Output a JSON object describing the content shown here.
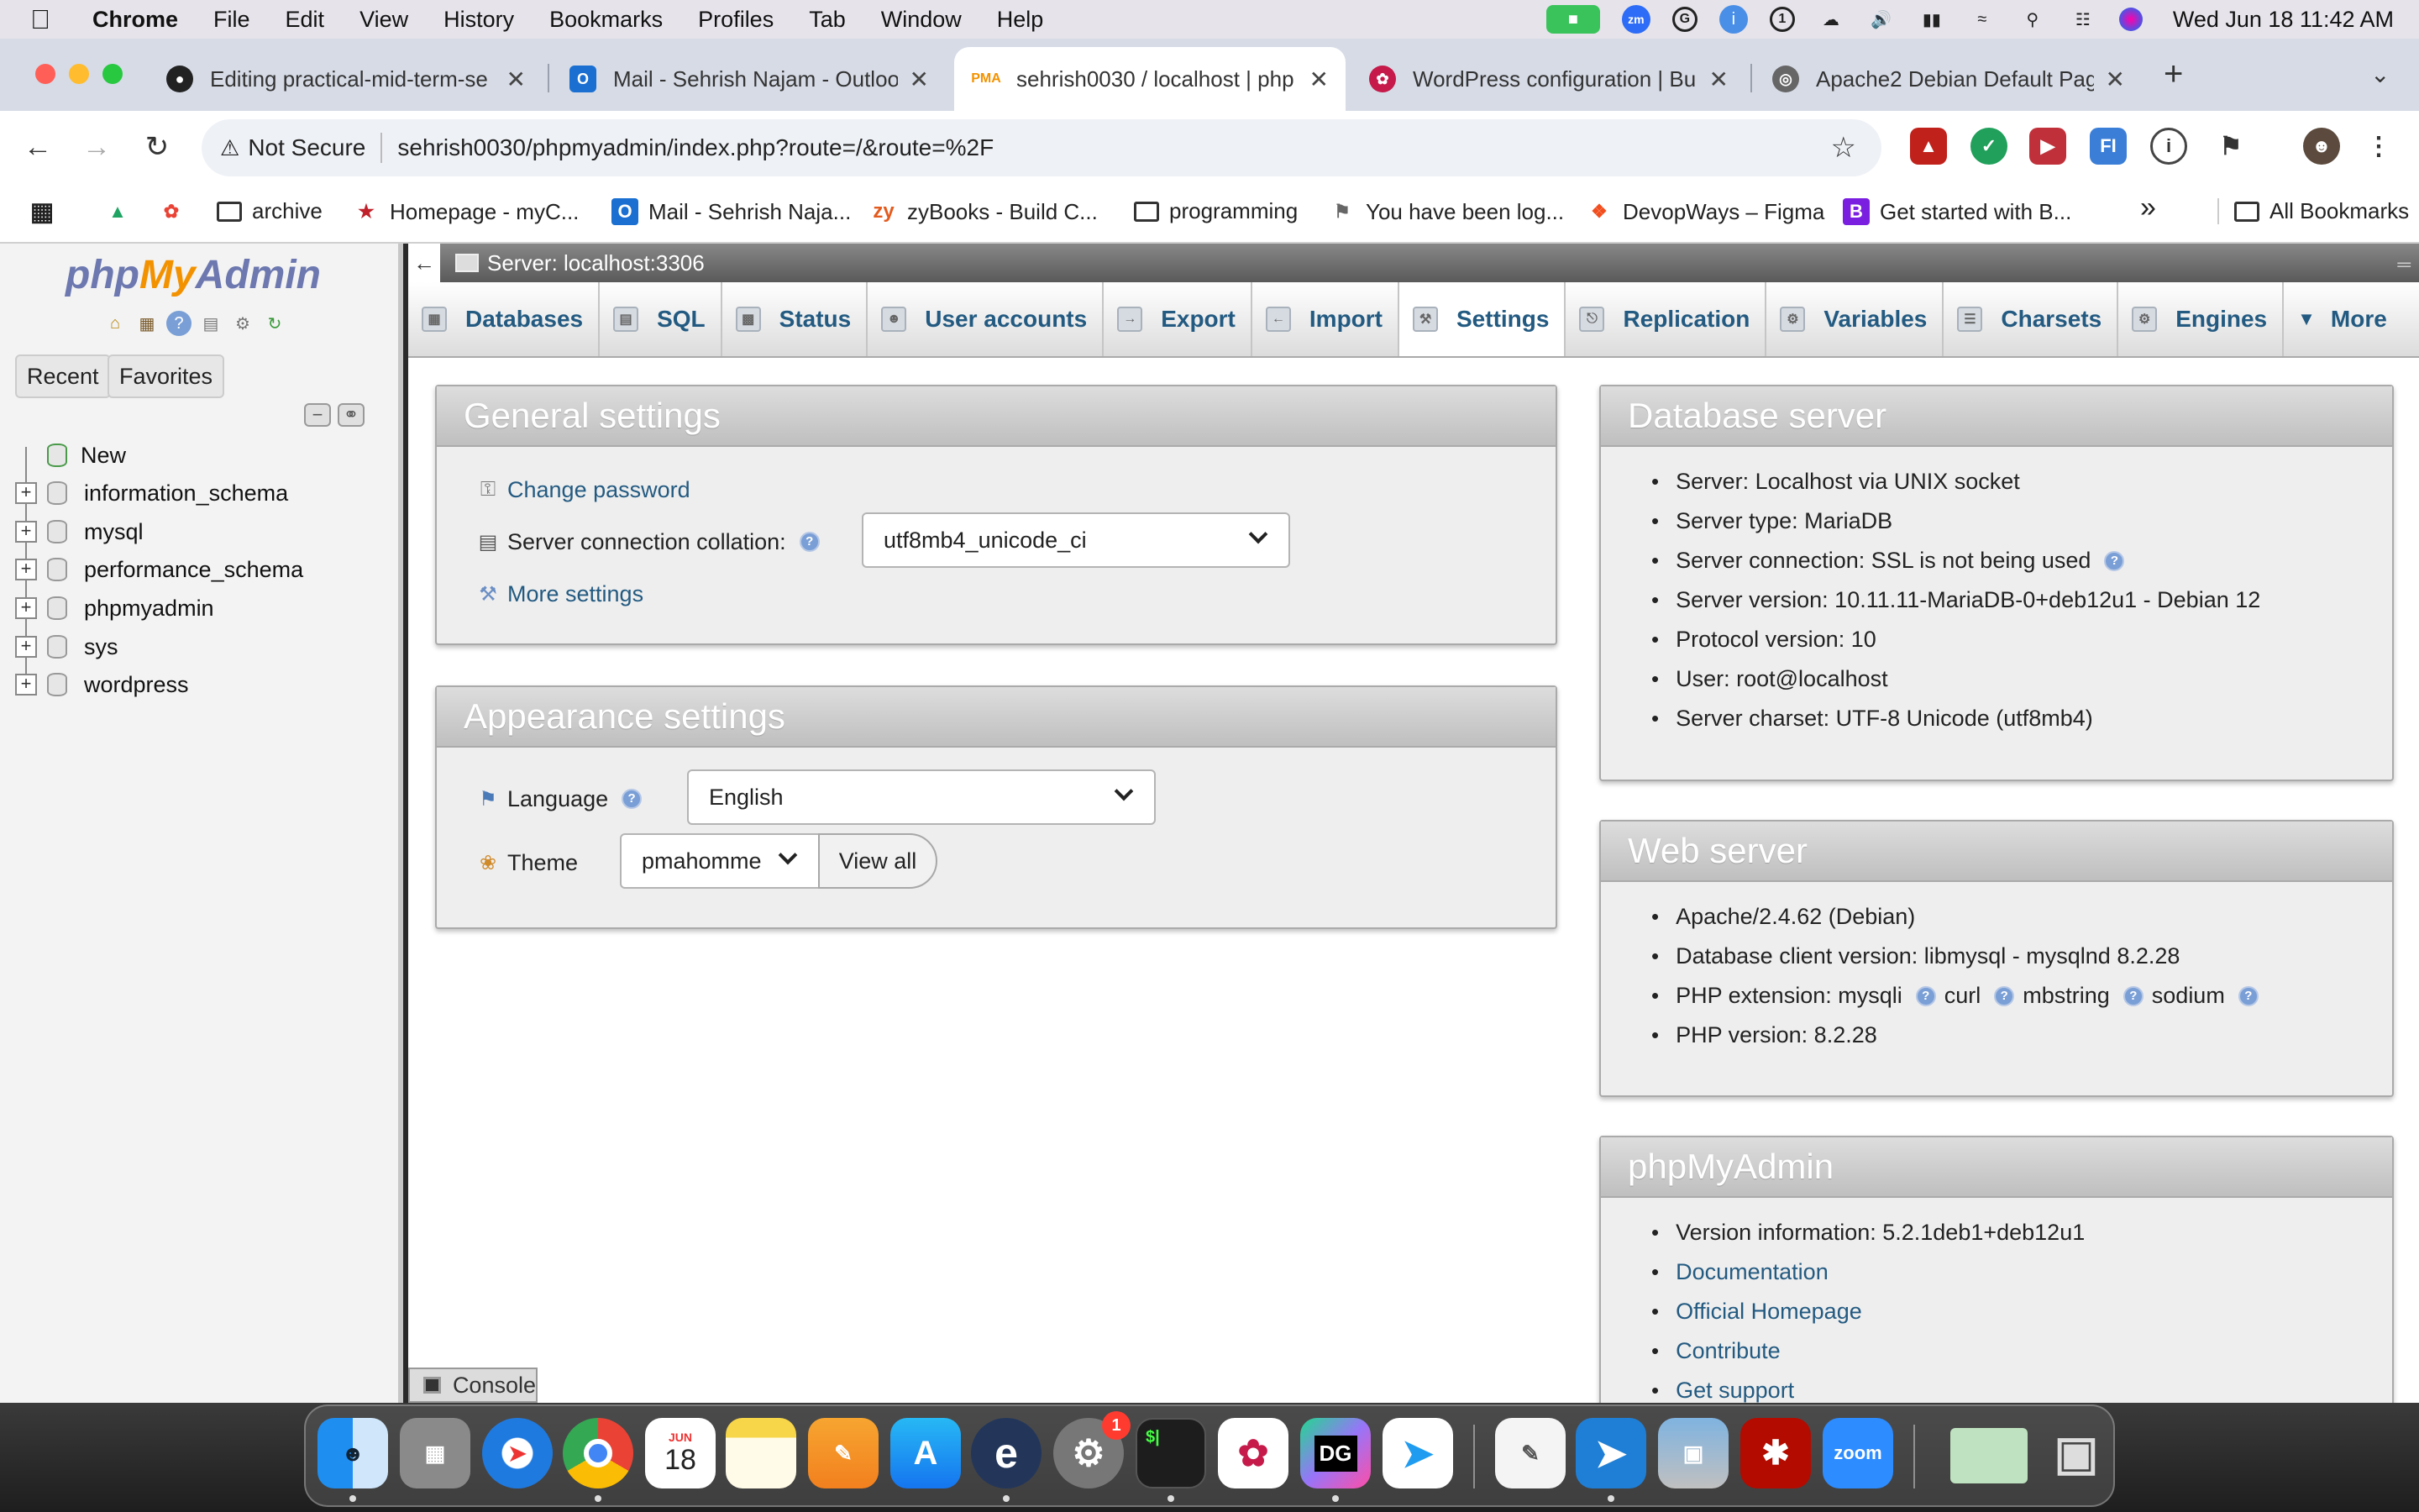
{
  "menubar": {
    "app_name": "Chrome",
    "menus": [
      "File",
      "Edit",
      "View",
      "History",
      "Bookmarks",
      "Profiles",
      "Tab",
      "Window",
      "Help"
    ],
    "clock": "Wed Jun 18  11:42 AM",
    "status_icons": [
      "facetime-icon",
      "zoom-icon",
      "grammarly-icon",
      "info-icon",
      "password-icon",
      "network-icon",
      "volume-icon",
      "battery-icon",
      "wifi-icon",
      "search-icon",
      "control-center-icon",
      "siri-icon"
    ]
  },
  "tabs": [
    {
      "title": "Editing practical-mid-term-se",
      "favicon": "github-icon"
    },
    {
      "title": "Mail - Sehrish Najam - Outloo",
      "favicon": "outlook-icon"
    },
    {
      "title": "sehrish0030 / localhost | php",
      "favicon": "phpmyadmin-icon",
      "active": true
    },
    {
      "title": "WordPress configuration | Bu",
      "favicon": "raspberry-icon"
    },
    {
      "title": "Apache2 Debian Default Page",
      "favicon": "globe-icon"
    }
  ],
  "toolbar": {
    "security": "Not Secure",
    "url": "sehrish0030/phpmyadmin/index.php?route=/&route=%2F"
  },
  "bookmarks": {
    "items": [
      "archive",
      "Homepage - myC...",
      "Mail - Sehrish Naja...",
      "zyBooks - Build C...",
      "programming",
      "You have been log...",
      "DevopWays – Figma",
      "Get started with B..."
    ],
    "overflow": "»",
    "all": "All Bookmarks"
  },
  "nav": {
    "logo": {
      "php": "php",
      "my": "My",
      "admin": "Admin"
    },
    "recent": "Recent",
    "favorites": "Favorites",
    "new_label": "New",
    "databases": [
      "information_schema",
      "mysql",
      "performance_schema",
      "phpmyadmin",
      "sys",
      "wordpress"
    ]
  },
  "server_bar": {
    "title": "Server: localhost:3306"
  },
  "main_tabs": [
    "Databases",
    "SQL",
    "Status",
    "User accounts",
    "Export",
    "Import",
    "Settings",
    "Replication",
    "Variables",
    "Charsets",
    "Engines",
    "More"
  ],
  "general_settings": {
    "title": "General settings",
    "change_password": "Change password",
    "collation_label": "Server connection collation:",
    "collation_value": "utf8mb4_unicode_ci",
    "more_settings": "More settings"
  },
  "appearance_settings": {
    "title": "Appearance settings",
    "language_label": "Language",
    "language_value": "English",
    "theme_label": "Theme",
    "theme_value": "pmahomme",
    "view_all": "View all"
  },
  "database_server": {
    "title": "Database server",
    "items": [
      "Server: Localhost via UNIX socket",
      "Server type: MariaDB",
      "Server connection: SSL is not being used",
      "Server version: 10.11.11-MariaDB-0+deb12u1 - Debian 12",
      "Protocol version: 10",
      "User: root@localhost",
      "Server charset: UTF-8 Unicode (utf8mb4)"
    ]
  },
  "web_server": {
    "title": "Web server",
    "apache": "Apache/2.4.62 (Debian)",
    "client": "Database client version: libmysql - mysqlnd 8.2.28",
    "php_ext_label": "PHP extension: mysqli",
    "ext_curl": "curl",
    "ext_mbstring": "mbstring",
    "ext_sodium": "sodium",
    "php_version": "PHP version: 8.2.28"
  },
  "pma_panel": {
    "title": "phpMyAdmin",
    "version": "Version information: 5.2.1deb1+deb12u1",
    "links": [
      "Documentation",
      "Official Homepage",
      "Contribute",
      "Get support"
    ]
  },
  "console": {
    "label": "Console"
  },
  "dock": {
    "calendar_month": "JUN",
    "calendar_day": "18",
    "settings_badge": "1",
    "apps": [
      "finder",
      "launchpad",
      "safari",
      "chrome",
      "calendar",
      "notes",
      "pages",
      "app-store",
      "eclipse",
      "system-settings",
      "terminal",
      "raspberry-pi-imager",
      "datagrip",
      "vscode",
      "textedit",
      "vscode-2",
      "preview",
      "acrobat",
      "zoom",
      "downloads",
      "trash"
    ]
  },
  "colors": {
    "pma_link": "#235a81",
    "panel_header": "#bfbfbf",
    "menubar": "#e6e3ea"
  }
}
